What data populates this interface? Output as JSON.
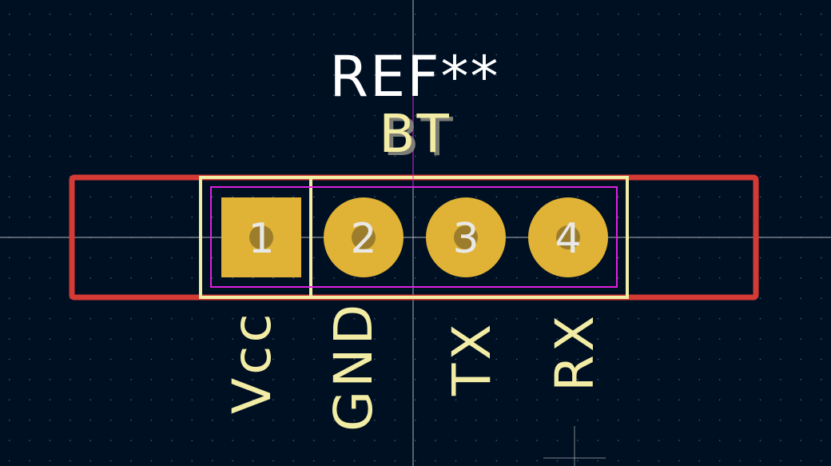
{
  "colors": {
    "background": "#001023",
    "grid_dot": "#4a5a73",
    "crosshair": "#d0d0d0",
    "courtyard": "#d63a34",
    "silkscreen": "#f2eca4",
    "fab": "#e020e0",
    "pad": "#e0b235",
    "pad_number": "#e8e8e8",
    "reference": "#ffffff"
  },
  "footprint": {
    "reference": "REF**",
    "value": "BT"
  },
  "pads": [
    {
      "number": "1",
      "shape": "square",
      "pin_label": "Vcc"
    },
    {
      "number": "2",
      "shape": "circle",
      "pin_label": "GND"
    },
    {
      "number": "3",
      "shape": "circle",
      "pin_label": "TX"
    },
    {
      "number": "4",
      "shape": "circle",
      "pin_label": "RX"
    }
  ]
}
